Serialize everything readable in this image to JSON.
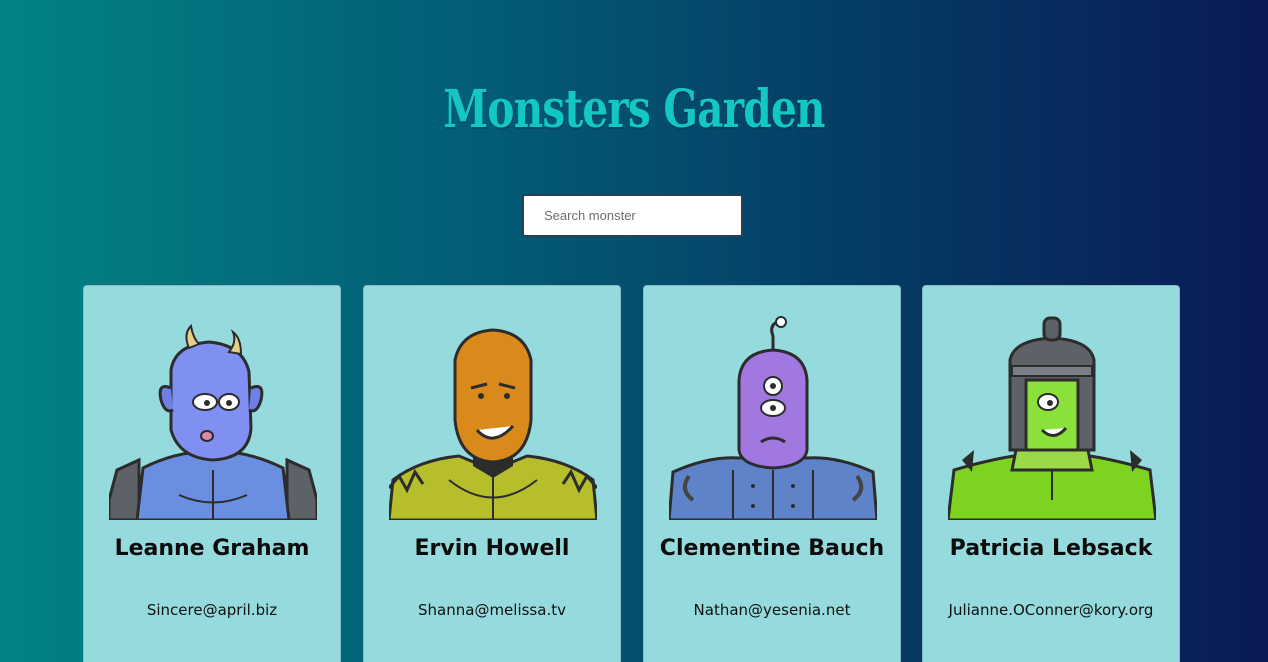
{
  "header": {
    "title": "Monsters Garden"
  },
  "search": {
    "placeholder": "Search monster",
    "value": ""
  },
  "monsters": [
    {
      "name": "Leanne Graham",
      "email": "Sincere@april.biz",
      "icon": "blue-horned-monster-icon"
    },
    {
      "name": "Ervin Howell",
      "email": "Shanna@melissa.tv",
      "icon": "orange-masked-monster-icon"
    },
    {
      "name": "Clementine Bauch",
      "email": "Nathan@yesenia.net",
      "icon": "purple-cyclops-monster-icon"
    },
    {
      "name": "Patricia Lebsack",
      "email": "Julianne.OConner@kory.org",
      "icon": "green-robot-monster-icon"
    }
  ],
  "colors": {
    "title": "#13c7c2",
    "card_background": "#95dadc",
    "page_gradient_start": "#028384",
    "page_gradient_end": "#0a1a55"
  }
}
